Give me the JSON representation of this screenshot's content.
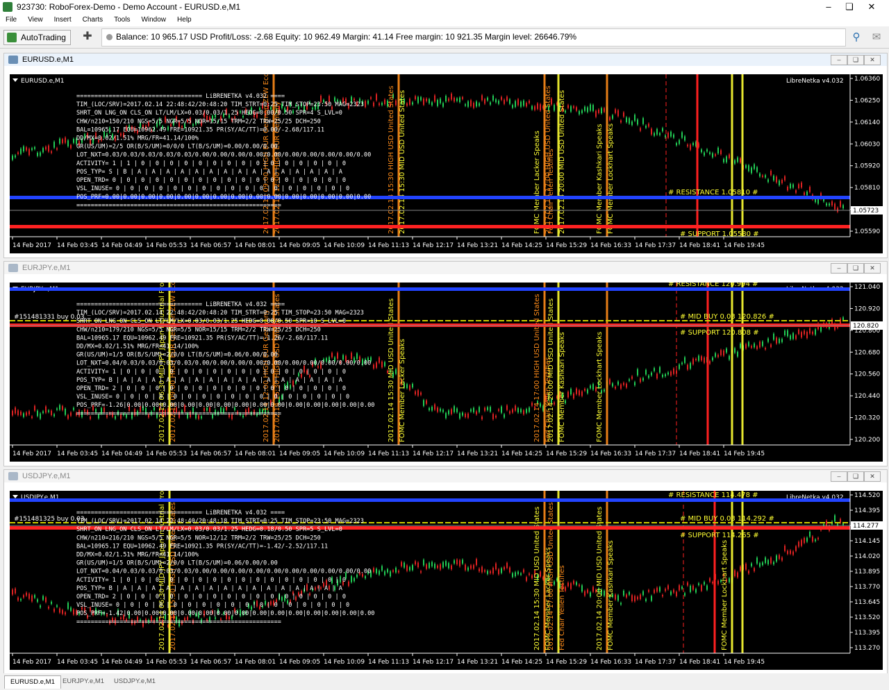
{
  "window": {
    "title": "923730: RoboForex-Demo - Demo Account - EURUSD.e,M1"
  },
  "menu": [
    "File",
    "View",
    "Insert",
    "Charts",
    "Tools",
    "Window",
    "Help"
  ],
  "toolbar": {
    "autotrading_label": "AutoTrading",
    "status_text": "Balance: 10 965.17 USD  Profit/Loss: -2.68  Equity: 10 962.49  Margin: 41.14  Free margin: 10 921.35  Margin level: 26646.79%"
  },
  "time_labels": [
    "14 Feb 2017",
    "14 Feb 03:45",
    "14 Feb 04:49",
    "14 Feb 05:53",
    "14 Feb 06:57",
    "14 Feb 08:01",
    "14 Feb 09:05",
    "14 Feb 10:09",
    "14 Feb 11:13",
    "14 Feb 12:17",
    "14 Feb 13:21",
    "14 Feb 14:25",
    "14 Feb 15:29",
    "14 Feb 16:33",
    "14 Feb 17:37",
    "14 Feb 18:41",
    "14 Feb 19:45"
  ],
  "charts": [
    {
      "window_title": "EURUSD.e,M1",
      "label": "EURUSD.e,M1",
      "indicator": "LibreNetka  v4.032",
      "price_ticks": [
        "1.06360",
        "1.06250",
        "1.06140",
        "1.06030",
        "1.05920",
        "1.05810",
        "1.05700",
        "1.05590"
      ],
      "current_price": "1.05723",
      "resistance": "# RESISTANCE 1.05810 #",
      "support": "# SUPPORT 1.05580 #",
      "mid": "",
      "order_label": "",
      "vertical_labels": [
        {
          "text": "2017.02.14 09:00 HIGH EUR German ZEW Economic Sentiment (Q1)",
          "color": "#ff8c1a"
        },
        {
          "text": "2017.02.14 12:00 HIGH EUR Germany",
          "color": "#ff8c1a"
        },
        {
          "text": "2017.02.14 15:30 HIGH USD United States",
          "color": "#ff8c1a"
        },
        {
          "text": "2017.02.14 15:30 MID USD United States",
          "color": "#ffff33"
        },
        {
          "text": "FOMC Member Lacker Speaks",
          "color": "#ffff33"
        },
        {
          "text": "2017.02.14 17:00 HIGH USD United States",
          "color": "#ff8c1a"
        },
        {
          "text": "Fed Chair Yellen Testifies",
          "color": "#ff8c1a"
        },
        {
          "text": "2017.02.14 20:00 MID USD United States",
          "color": "#ffff33"
        },
        {
          "text": "FOMC Member Kashkari Speaks",
          "color": "#ffff33"
        },
        {
          "text": "FOMC Member Lockhart Speaks",
          "color": "#ffff33"
        }
      ],
      "info_lines": [
        "=================================== LiBRENETKA v4.032 ====",
        "TIM_(LOC/SRV)=2017.02.14 22:48:42/20:48:20 TIM_STRT=0:25 TIM_STOP=23:50  MAG=2323",
        "SHRT_ON LNG_ON CLS_ON LT/LM/LX=0.03/0.03/1.25 HEDG=0.00/0.50 SPR=4 S_LVL=0",
        "CHW/n210=150/210 NGS=5/5 NGR=5/5 NOR=15/15 TRM=2/2 TRW=25/25 DCH=250",
        "BAL=10965.17 EQU=10962.49 FRE=10921.35 PR(SY/AC/TT)=0.00/-2.68/117.11",
        "DD/MX=0.02/1.51% MRG/FR=41.14/100%",
        "GR(US/UM)=2/5 OR(B/S/UM)=0/0/0 LT(B/S/UM)=0.00/0.00/0.00",
        "LOT_NXT=0.03/0.03/0.03/0.03/0.03/0.00/0.00/0.00/0.00/0.00/0.00/0.00/0.00/0.00/0.00",
        "ACTIVITY=  1 | 1 | 0 | 0 | 0 | 0 | 0 | 0 | 0 | 0 | 0 | 0 | 0 | 0 | 0 | 0 | 0",
        "POS_TYP=   S | B | A | A | A | A | A | A | A | A | A | A | A | A | A | A | A",
        "OPEN_TRD=  0 | 0 | 0 | 0 | 0 | 0 | 0 | 0 | 0 | 0 | 0 | 0 | 0 | 0 | 0 | 0 | 0",
        "VSL_INUSE= 0 | 0 | 0 | 0 | 0 | 0 | 0 | 0 | 0 | 0 | 0 | 0 | 0 | 0 | 0 | 0 | 0",
        "POS_PRF=0.00|0.00|0.00|0.00|0.00|0.00|0.00|0.00|0.00|0.00|0.00|0.00|0.00|0.00|0.00",
        "========================================================="
      ]
    },
    {
      "window_title": "EURJPY.e,M1",
      "label": "EURJPY.e,M1",
      "indicator": "LibreNetka  v4.032",
      "price_ticks": [
        "121.040",
        "120.920",
        "120.800",
        "120.680",
        "120.560",
        "120.440",
        "120.320",
        "120.200"
      ],
      "current_price": "120.820",
      "resistance": "# RESISTANCE 120.994  #",
      "support": "# SUPPORT 120.808  #",
      "mid": "#  MID BUY 0.03 120.826  #",
      "order_label": "#151481331 buy 0.03",
      "vertical_labels": [
        {
          "text": "2017.02.14 06:30 MID JPY Japan Industrial Production",
          "color": "#ffff33"
        },
        {
          "text": "2017.02.14 09:00 HIGH EUR German ZEW Economic Sentiment (Q1)",
          "color": "#ff8c1a"
        },
        {
          "text": "2017.02.14 12:00 HIGH EUR Germany",
          "color": "#ff8c1a"
        },
        {
          "text": "2017.02.14 15:30 HIGH USD United States",
          "color": "#ff8c1a"
        },
        {
          "text": "2017.02.14 15:30 MID USD United States",
          "color": "#ffff33"
        },
        {
          "text": "FOMC Member Lacker Speaks",
          "color": "#ffff33"
        },
        {
          "text": "2017.02.14 17:00 HIGH USD United States",
          "color": "#ff8c1a"
        },
        {
          "text": "Fed Chair Yellen Testifies",
          "color": "#ff8c1a"
        },
        {
          "text": "2017.02.14 20:00 MID USD United States",
          "color": "#ffff33"
        },
        {
          "text": "FOMC Member Kashkari Speaks",
          "color": "#ffff33"
        },
        {
          "text": "FOMC Member Lockhart Speaks",
          "color": "#ffff33"
        }
      ],
      "info_lines": [
        "=================================== LiBRENETKA v4.032 ====",
        "TIM_(LOC/SRV)=2017.02.14 22:48:42/20:48:20 TIM_STRT=0:25 TIM_STOP=23:50  MAG=2323",
        "SHRT_ON LNG_ON CLS_ON LT/LM/LX=0.03/0.03/1.25 HEDG=0.08/0.50 SPR=10 S_LVL=0",
        "CHW/n210=179/210 NGS=5/5 NGR=5/5 NOR=15/15 TRM=2/2 TRW=25/25 DCH=250",
        "BAL=10965.17 EQU=10962.49 FRE=10921.35 PR(SY/AC/TT)=-1.26/-2.68/117.11",
        "DD/MX=0.02/1.51% MRG/FR=41.14/100%",
        "GR(US/UM)=1/5 OR(B/S/UM)=2/0/0 LT(B/S/UM)=0.06/0.00/0.00",
        "LOT_NXT=0.04/0.03/0.03/0.03/0.03/0.00/0.00/0.00/0.00/0.00/0.00/0.00/0.00/0.00/0.00",
        "ACTIVITY=  1 | 0 | 0 | 0 | 0 | 0 | 0 | 0 | 0 | 0 | 0 | 0 | 0 | 0 | 0 | 0 | 0",
        "POS_TYP=   B | A | A | A | A | A | A | A | A | A | A | A | A | A | A | A | A",
        "OPEN_TRD=  2 | 0 | 0 | 0 | 0 | 0 | 0 | 0 | 0 | 0 | 0 | 0 | 0 | 0 | 0 | 0 | 0",
        "VSL_INUSE= 0 | 0 | 0 | 0 | 0 | 0 | 0 | 0 | 0 | 0 | 0 | 0 | 0 | 0 | 0 | 0 | 0",
        "POS_PRF=-1.26|0.00|0.00|0.00|0.00|0.00|0.00|0.00|0.00|0.00|0.00|0.00|0.00|0.00|0.00",
        "========================================================="
      ]
    },
    {
      "window_title": "USDJPY.e,M1",
      "label": "USDJPY.e,M1",
      "indicator": "LibreNetka  v4.032",
      "price_ticks": [
        "114.520",
        "114.395",
        "114.270",
        "114.145",
        "114.020",
        "113.895",
        "113.770",
        "113.645",
        "113.520",
        "113.395",
        "113.270"
      ],
      "current_price": "114.277",
      "resistance": "# RESISTANCE 114.478  #",
      "support": "# SUPPORT 114.265  #",
      "mid": "#  MID BUY 0.03 114.292  #",
      "order_label": "#151481325 buy 0.03",
      "vertical_labels": [
        {
          "text": "2017.02.14 06:30 MID JPY Japan Industrial Production",
          "color": "#ffff33"
        },
        {
          "text": "2017.02.14 15:30 HIGH USD United States",
          "color": "#ff8c1a"
        },
        {
          "text": "2017.02.14 15:30 MID USD United States",
          "color": "#ffff33"
        },
        {
          "text": "FOMC Member Lacker Speaks",
          "color": "#ffff33"
        },
        {
          "text": "2017.02.14 17:00 HIGH USD United States",
          "color": "#ff8c1a"
        },
        {
          "text": "Fed Chair Yellen Testifies",
          "color": "#ff8c1a"
        },
        {
          "text": "2017.02.14 20:00 MID USD United States",
          "color": "#ffff33"
        },
        {
          "text": "FOMC Member Kashkari Speaks",
          "color": "#ffff33"
        },
        {
          "text": "FOMC Member Lockhart Speaks",
          "color": "#ffff33"
        }
      ],
      "info_lines": [
        "=================================== LiBRENETKA v4.032 ====",
        "TIM_(LOC/SRV)=2017.02.14 22:48:40/20:48:18 TIM_STRT=0:25 TIM_STOP=23:50  MAG=2323",
        "SHRT_ON LNG_ON CLS_ON LT/LM/LX=0.03/0.03/1.25 HEDG=0.18/0.50 SPR=5 S_LVL=0",
        "CHW/n210=216/210 NGS=5/5 NGR=5/5 NOR=12/12 TRM=2/2 TRW=25/25 DCH=250",
        "BAL=10965.17 EQU=10962.49 FRE=10921.35 PR(SY/AC/TT)=-1.42/-2.52/117.11",
        "DD/MX=0.02/1.51% MRG/FR=41.14/100%",
        "GR(US/UM)=1/5 OR(B/S/UM)=2/0/0 LT(B/S/UM)=0.06/0.00/0.00",
        "LOT_NXT=0.04/0.03/0.03/0.03/0.03/0.00/0.00/0.00/0.00/0.00/0.00/0.00/0.00/0.00/0.00",
        "ACTIVITY=  1 | 0 | 0 | 0 | 0 | 0 | 0 | 0 | 0 | 0 | 0 | 0 | 0 | 0 | 0 | 0 | 0",
        "POS_TYP=   B | A | A | A | A | A | A | A | A | A | A | A | A | A | A | A | A",
        "OPEN_TRD=  2 | 0 | 0 | 0 | 0 | 0 | 0 | 0 | 0 | 0 | 0 | 0 | 0 | 0 | 0 | 0 | 0",
        "VSL_INUSE= 0 | 0 | 0 | 0 | 0 | 0 | 0 | 0 | 0 | 0 | 0 | 0 | 0 | 0 | 0 | 0 | 0",
        "POS_PRF=-1.42|0.00|0.00|0.00|0.00|0.00|0.00|0.00|0.00|0.00|0.00|0.00|0.00|0.00|0.00",
        "========================================================="
      ]
    }
  ],
  "tabs": [
    "EURUSD.e,M1",
    "EURJPY.e,M1",
    "USDJPY.e,M1"
  ],
  "colors": {
    "chart_bg": "#000000",
    "resistance_line": "#2244ff",
    "support_line": "#ff2222",
    "mid_line": "#cccc00",
    "bull_candle": "#22cc55",
    "bear_candle": "#dd2222",
    "event_high": "#ff8c1a",
    "event_mid": "#ffff33",
    "grid_text": "#ffffff"
  }
}
